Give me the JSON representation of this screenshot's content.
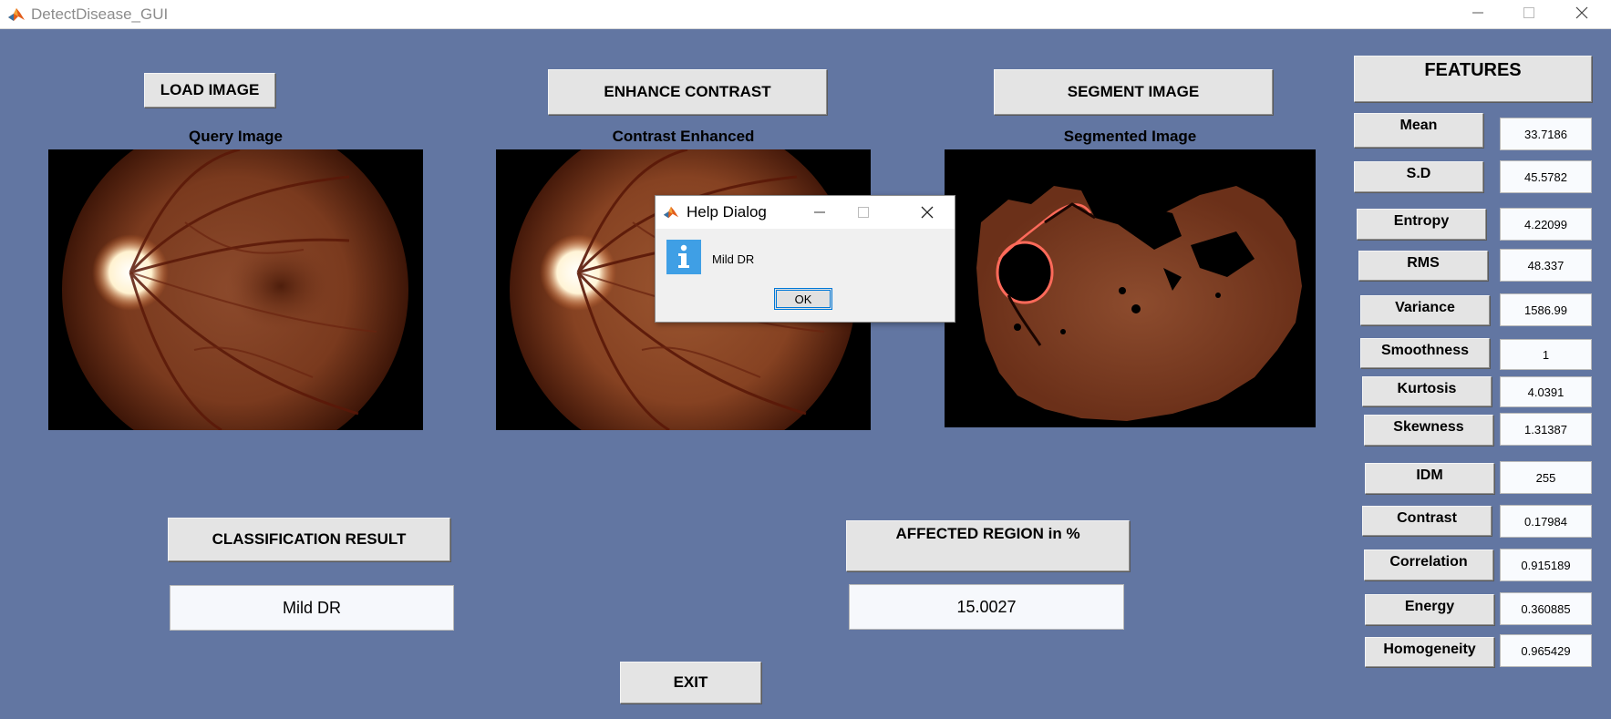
{
  "window": {
    "title": "DetectDisease_GUI"
  },
  "buttons": {
    "load_image": "LOAD IMAGE",
    "enhance_contrast": "ENHANCE CONTRAST",
    "segment_image": "SEGMENT IMAGE",
    "classification_result": "CLASSIFICATION RESULT",
    "affected_region": "AFFECTED REGION in %",
    "exit": "EXIT"
  },
  "captions": {
    "query": "Query Image",
    "enhanced": "Contrast Enhanced",
    "segmented": "Segmented Image"
  },
  "results": {
    "classification": "Mild DR",
    "affected_percent": "15.0027"
  },
  "features": {
    "header": "FEATURES",
    "items": [
      {
        "label": "Mean",
        "value": "33.7186"
      },
      {
        "label": "S.D",
        "value": "45.5782"
      },
      {
        "label": "Entropy",
        "value": "4.22099"
      },
      {
        "label": "RMS",
        "value": "48.337"
      },
      {
        "label": "Variance",
        "value": "1586.99"
      },
      {
        "label": "Smoothness",
        "value": "1"
      },
      {
        "label": "Kurtosis",
        "value": "4.0391"
      },
      {
        "label": "Skewness",
        "value": "1.31387"
      },
      {
        "label": "IDM",
        "value": "255"
      },
      {
        "label": "Contrast",
        "value": "0.17984"
      },
      {
        "label": "Correlation",
        "value": "0.915189"
      },
      {
        "label": "Energy",
        "value": "0.360885"
      },
      {
        "label": "Homogeneity",
        "value": "0.965429"
      }
    ]
  },
  "dialog": {
    "title": "Help Dialog",
    "message": "Mild DR",
    "ok_label": "OK",
    "icon": "info-icon"
  },
  "colors": {
    "background": "#6276a2",
    "button_face": "#e4e4e4",
    "info_blue": "#3f9fe5"
  }
}
